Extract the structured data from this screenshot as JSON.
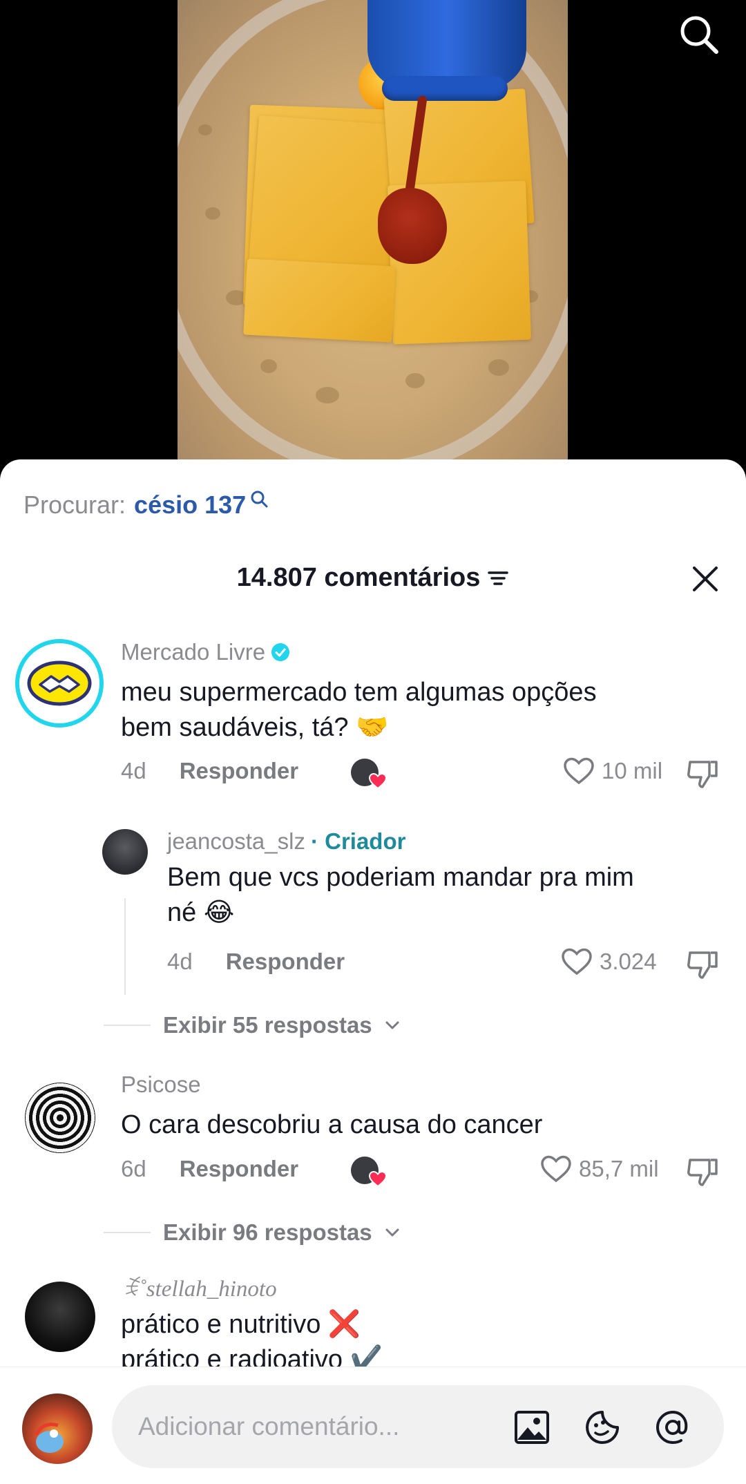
{
  "video": {
    "search_icon": "search-icon"
  },
  "search_suggestion": {
    "prefix": "Procurar:",
    "term": "césio 137"
  },
  "header": {
    "title": "14.807 comentários"
  },
  "comments": [
    {
      "username": "Mercado Livre",
      "verified": true,
      "text_line1": "meu supermercado tem algumas opções",
      "text_line2": "bem saudáveis, tá? 🤝",
      "time": "4d",
      "reply_label": "Responder",
      "likes": "10 mil",
      "creator_liked": true
    },
    {
      "username": "jeancosta_slz",
      "tag": "· Criador",
      "text_line1": "Bem que vcs poderiam mandar pra mim",
      "text_line2": "né 😂",
      "time": "4d",
      "reply_label": "Responder",
      "likes": "3.024"
    },
    {
      "username": "Psicose",
      "text_line1": "O cara descobriu a causa do cancer",
      "time": "6d",
      "reply_label": "Responder",
      "likes": "85,7 mil",
      "creator_liked": true
    },
    {
      "username": "ꉂ˚stellah_hinoto",
      "text_line1": "prático e nutritivo ❌",
      "text_line2": "prático e radioativo ✔️"
    }
  ],
  "view_replies": [
    {
      "label": "Exibir 55 respostas"
    },
    {
      "label": "Exibir 96 respostas"
    }
  ],
  "input": {
    "placeholder": "Adicionar comentário..."
  },
  "colors": {
    "link_blue": "#2b5aa8",
    "creator_teal": "#1f8a9c",
    "verified": "#20d5ec",
    "heart_red": "#fe2c55"
  }
}
